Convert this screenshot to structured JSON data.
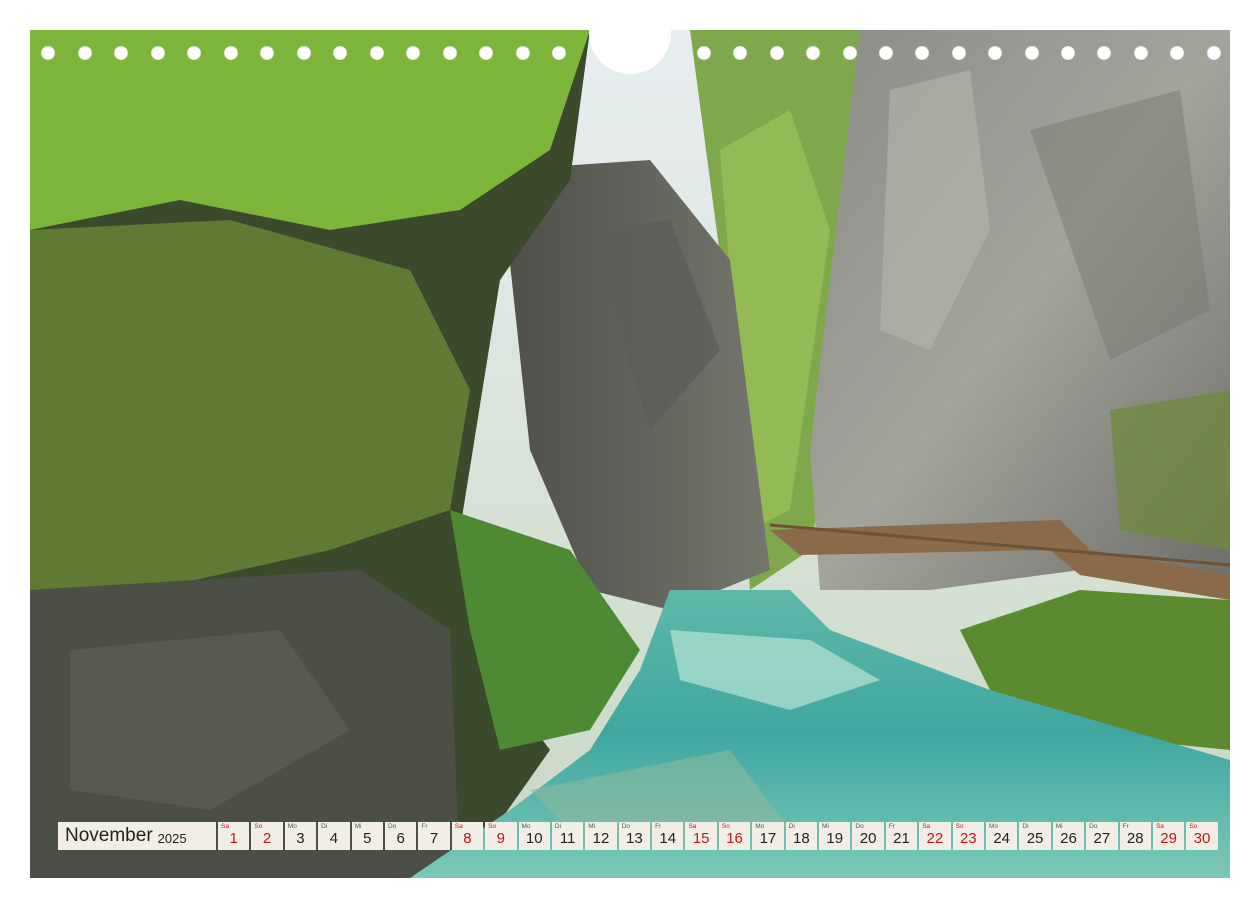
{
  "calendar": {
    "month": "November",
    "year": "2025",
    "days": [
      {
        "weekday": "Sa",
        "day": "1",
        "weekend": true
      },
      {
        "weekday": "So",
        "day": "2",
        "weekend": true
      },
      {
        "weekday": "Mo",
        "day": "3",
        "weekend": false
      },
      {
        "weekday": "Di",
        "day": "4",
        "weekend": false
      },
      {
        "weekday": "Mi",
        "day": "5",
        "weekend": false
      },
      {
        "weekday": "Do",
        "day": "6",
        "weekend": false
      },
      {
        "weekday": "Fr",
        "day": "7",
        "weekend": false
      },
      {
        "weekday": "Sa",
        "day": "8",
        "weekend": true
      },
      {
        "weekday": "So",
        "day": "9",
        "weekend": true
      },
      {
        "weekday": "Mo",
        "day": "10",
        "weekend": false
      },
      {
        "weekday": "Di",
        "day": "11",
        "weekend": false
      },
      {
        "weekday": "Mi",
        "day": "12",
        "weekend": false
      },
      {
        "weekday": "Do",
        "day": "13",
        "weekend": false
      },
      {
        "weekday": "Fr",
        "day": "14",
        "weekend": false
      },
      {
        "weekday": "Sa",
        "day": "15",
        "weekend": true
      },
      {
        "weekday": "So",
        "day": "16",
        "weekend": true
      },
      {
        "weekday": "Mo",
        "day": "17",
        "weekend": false
      },
      {
        "weekday": "Di",
        "day": "18",
        "weekend": false
      },
      {
        "weekday": "Mi",
        "day": "19",
        "weekend": false
      },
      {
        "weekday": "Do",
        "day": "20",
        "weekend": false
      },
      {
        "weekday": "Fr",
        "day": "21",
        "weekend": false
      },
      {
        "weekday": "Sa",
        "day": "22",
        "weekend": true
      },
      {
        "weekday": "So",
        "day": "23",
        "weekend": true
      },
      {
        "weekday": "Mo",
        "day": "24",
        "weekend": false
      },
      {
        "weekday": "Di",
        "day": "25",
        "weekend": false
      },
      {
        "weekday": "Mi",
        "day": "26",
        "weekend": false
      },
      {
        "weekday": "Do",
        "day": "27",
        "weekend": false
      },
      {
        "weekday": "Fr",
        "day": "28",
        "weekend": false
      },
      {
        "weekday": "Sa",
        "day": "29",
        "weekend": true
      },
      {
        "weekday": "So",
        "day": "30",
        "weekend": true
      }
    ]
  },
  "colors": {
    "weekend": "#c4161c",
    "weekday": "#222222",
    "cell_background": "#f1eee6"
  }
}
